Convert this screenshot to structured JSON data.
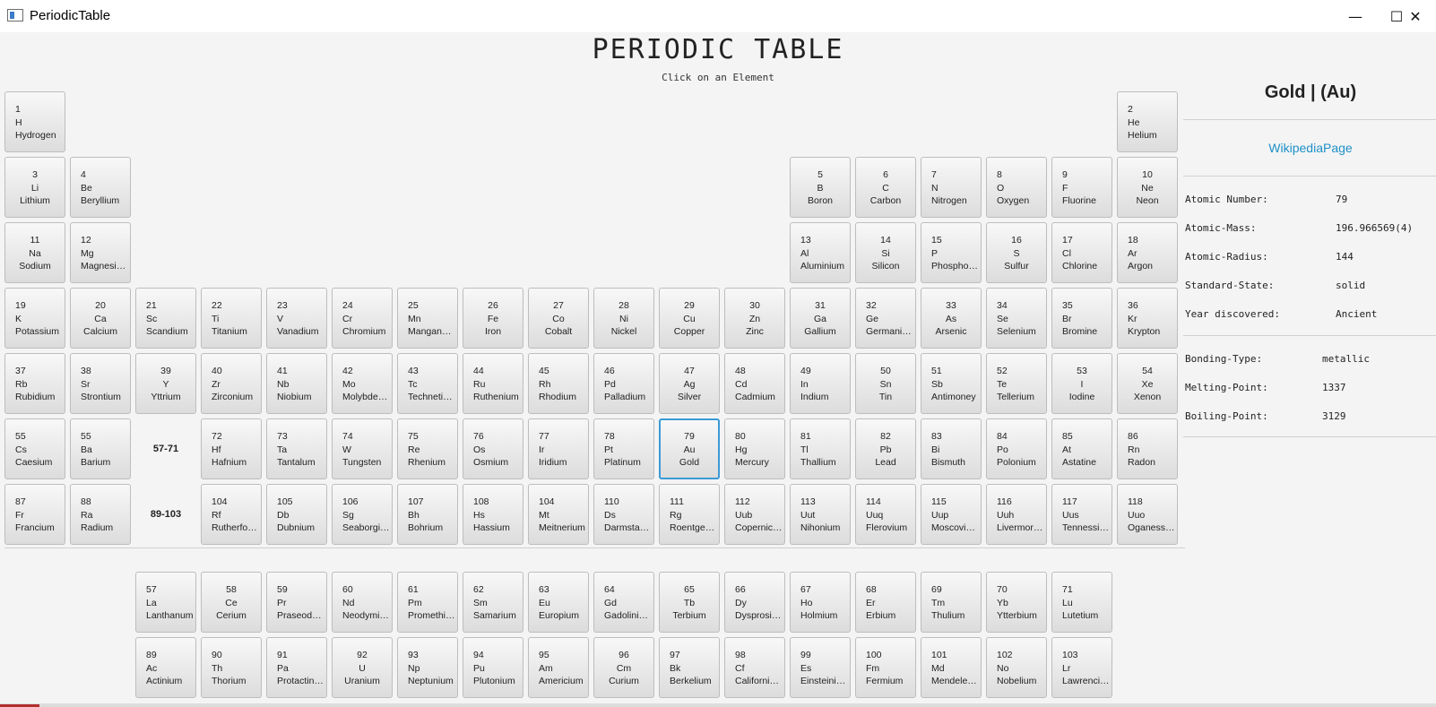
{
  "window": {
    "title": "PeriodicTable",
    "minimize_glyph": "—",
    "maximize_glyph": "☐",
    "close_glyph": "✕"
  },
  "header": {
    "title": "PERIODIC TABLE",
    "subtitle": "Click on an Element"
  },
  "elements": [
    {
      "n": "1",
      "s": "H",
      "name": "Hydrogen",
      "align": "l",
      "r": 0,
      "c": 0
    },
    {
      "n": "2",
      "s": "He",
      "name": "Helium",
      "align": "l",
      "r": 0,
      "c": 17
    },
    {
      "n": "3",
      "s": "Li",
      "name": "Lithium",
      "align": "c",
      "r": 1,
      "c": 0
    },
    {
      "n": "4",
      "s": "Be",
      "name": "Beryllium",
      "align": "l",
      "r": 1,
      "c": 1
    },
    {
      "n": "5",
      "s": "B",
      "name": "Boron",
      "align": "c",
      "r": 1,
      "c": 12
    },
    {
      "n": "6",
      "s": "C",
      "name": "Carbon",
      "align": "c",
      "r": 1,
      "c": 13
    },
    {
      "n": "7",
      "s": "N",
      "name": "Nitrogen",
      "align": "l",
      "r": 1,
      "c": 14
    },
    {
      "n": "8",
      "s": "O",
      "name": "Oxygen",
      "align": "l",
      "r": 1,
      "c": 15
    },
    {
      "n": "9",
      "s": "F",
      "name": "Fluorine",
      "align": "l",
      "r": 1,
      "c": 16
    },
    {
      "n": "10",
      "s": "Ne",
      "name": "Neon",
      "align": "c",
      "r": 1,
      "c": 17
    },
    {
      "n": "11",
      "s": "Na",
      "name": "Sodium",
      "align": "c",
      "r": 2,
      "c": 0
    },
    {
      "n": "12",
      "s": "Mg",
      "name": "Magnesium",
      "align": "l",
      "r": 2,
      "c": 1
    },
    {
      "n": "13",
      "s": "Al",
      "name": "Aluminium",
      "align": "l",
      "r": 2,
      "c": 12
    },
    {
      "n": "14",
      "s": "Si",
      "name": "Silicon",
      "align": "c",
      "r": 2,
      "c": 13
    },
    {
      "n": "15",
      "s": "P",
      "name": "Phosphorus",
      "align": "l",
      "r": 2,
      "c": 14
    },
    {
      "n": "16",
      "s": "S",
      "name": "Sulfur",
      "align": "c",
      "r": 2,
      "c": 15
    },
    {
      "n": "17",
      "s": "Cl",
      "name": "Chlorine",
      "align": "l",
      "r": 2,
      "c": 16
    },
    {
      "n": "18",
      "s": "Ar",
      "name": "Argon",
      "align": "l",
      "r": 2,
      "c": 17
    },
    {
      "n": "19",
      "s": "K",
      "name": "Potassium",
      "align": "l",
      "r": 3,
      "c": 0
    },
    {
      "n": "20",
      "s": "Ca",
      "name": "Calcium",
      "align": "c",
      "r": 3,
      "c": 1
    },
    {
      "n": "21",
      "s": "Sc",
      "name": "Scandium",
      "align": "l",
      "r": 3,
      "c": 2
    },
    {
      "n": "22",
      "s": "Ti",
      "name": "Titanium",
      "align": "l",
      "r": 3,
      "c": 3
    },
    {
      "n": "23",
      "s": "V",
      "name": "Vanadium",
      "align": "l",
      "r": 3,
      "c": 4
    },
    {
      "n": "24",
      "s": "Cr",
      "name": "Chromium",
      "align": "l",
      "r": 3,
      "c": 5
    },
    {
      "n": "25",
      "s": "Mn",
      "name": "Manganese",
      "align": "l",
      "r": 3,
      "c": 6
    },
    {
      "n": "26",
      "s": "Fe",
      "name": "Iron",
      "align": "c",
      "r": 3,
      "c": 7
    },
    {
      "n": "27",
      "s": "Co",
      "name": "Cobalt",
      "align": "c",
      "r": 3,
      "c": 8
    },
    {
      "n": "28",
      "s": "Ni",
      "name": "Nickel",
      "align": "c",
      "r": 3,
      "c": 9
    },
    {
      "n": "29",
      "s": "Cu",
      "name": "Copper",
      "align": "c",
      "r": 3,
      "c": 10
    },
    {
      "n": "30",
      "s": "Zn",
      "name": "Zinc",
      "align": "c",
      "r": 3,
      "c": 11
    },
    {
      "n": "31",
      "s": "Ga",
      "name": "Gallium",
      "align": "c",
      "r": 3,
      "c": 12
    },
    {
      "n": "32",
      "s": "Ge",
      "name": "Germanium",
      "align": "l",
      "r": 3,
      "c": 13
    },
    {
      "n": "33",
      "s": "As",
      "name": "Arsenic",
      "align": "c",
      "r": 3,
      "c": 14
    },
    {
      "n": "34",
      "s": "Se",
      "name": "Selenium",
      "align": "l",
      "r": 3,
      "c": 15
    },
    {
      "n": "35",
      "s": "Br",
      "name": "Bromine",
      "align": "l",
      "r": 3,
      "c": 16
    },
    {
      "n": "36",
      "s": "Kr",
      "name": "Krypton",
      "align": "l",
      "r": 3,
      "c": 17
    },
    {
      "n": "37",
      "s": "Rb",
      "name": "Rubidium",
      "align": "l",
      "r": 4,
      "c": 0
    },
    {
      "n": "38",
      "s": "Sr",
      "name": "Strontium",
      "align": "l",
      "r": 4,
      "c": 1
    },
    {
      "n": "39",
      "s": "Y",
      "name": "Yttrium",
      "align": "c",
      "r": 4,
      "c": 2
    },
    {
      "n": "40",
      "s": "Zr",
      "name": "Zirconium",
      "align": "l",
      "r": 4,
      "c": 3
    },
    {
      "n": "41",
      "s": "Nb",
      "name": "Niobium",
      "align": "l",
      "r": 4,
      "c": 4
    },
    {
      "n": "42",
      "s": "Mo",
      "name": "Molybde…",
      "align": "l",
      "r": 4,
      "c": 5
    },
    {
      "n": "43",
      "s": "Tc",
      "name": "Technetium",
      "align": "l",
      "r": 4,
      "c": 6
    },
    {
      "n": "44",
      "s": "Ru",
      "name": "Ruthenium",
      "align": "l",
      "r": 4,
      "c": 7
    },
    {
      "n": "45",
      "s": "Rh",
      "name": "Rhodium",
      "align": "l",
      "r": 4,
      "c": 8
    },
    {
      "n": "46",
      "s": "Pd",
      "name": "Palladium",
      "align": "l",
      "r": 4,
      "c": 9
    },
    {
      "n": "47",
      "s": "Ag",
      "name": "Silver",
      "align": "c",
      "r": 4,
      "c": 10
    },
    {
      "n": "48",
      "s": "Cd",
      "name": "Cadmium",
      "align": "l",
      "r": 4,
      "c": 11
    },
    {
      "n": "49",
      "s": "In",
      "name": "Indium",
      "align": "l",
      "r": 4,
      "c": 12
    },
    {
      "n": "50",
      "s": "Sn",
      "name": "Tin",
      "align": "c",
      "r": 4,
      "c": 13
    },
    {
      "n": "51",
      "s": "Sb",
      "name": "Antimoney",
      "align": "l",
      "r": 4,
      "c": 14
    },
    {
      "n": "52",
      "s": "Te",
      "name": "Tellerium",
      "align": "l",
      "r": 4,
      "c": 15
    },
    {
      "n": "53",
      "s": "I",
      "name": "Iodine",
      "align": "c",
      "r": 4,
      "c": 16
    },
    {
      "n": "54",
      "s": "Xe",
      "name": "Xenon",
      "align": "c",
      "r": 4,
      "c": 17
    },
    {
      "n": "55",
      "s": "Cs",
      "name": "Caesium",
      "align": "l",
      "r": 5,
      "c": 0
    },
    {
      "n": "55",
      "s": "Ba",
      "name": "Barium",
      "align": "l",
      "r": 5,
      "c": 1
    },
    {
      "n": "72",
      "s": "Hf",
      "name": "Hafnium",
      "align": "l",
      "r": 5,
      "c": 3
    },
    {
      "n": "73",
      "s": "Ta",
      "name": "Tantalum",
      "align": "l",
      "r": 5,
      "c": 4
    },
    {
      "n": "74",
      "s": "W",
      "name": "Tungsten",
      "align": "l",
      "r": 5,
      "c": 5
    },
    {
      "n": "75",
      "s": "Re",
      "name": "Rhenium",
      "align": "l",
      "r": 5,
      "c": 6
    },
    {
      "n": "76",
      "s": "Os",
      "name": "Osmium",
      "align": "l",
      "r": 5,
      "c": 7
    },
    {
      "n": "77",
      "s": "Ir",
      "name": "Iridium",
      "align": "l",
      "r": 5,
      "c": 8
    },
    {
      "n": "78",
      "s": "Pt",
      "name": "Platinum",
      "align": "l",
      "r": 5,
      "c": 9
    },
    {
      "n": "79",
      "s": "Au",
      "name": "Gold",
      "align": "c",
      "r": 5,
      "c": 10,
      "selected": true
    },
    {
      "n": "80",
      "s": "Hg",
      "name": "Mercury",
      "align": "l",
      "r": 5,
      "c": 11
    },
    {
      "n": "81",
      "s": "Tl",
      "name": "Thallium",
      "align": "l",
      "r": 5,
      "c": 12
    },
    {
      "n": "82",
      "s": "Pb",
      "name": "Lead",
      "align": "c",
      "r": 5,
      "c": 13
    },
    {
      "n": "83",
      "s": "Bi",
      "name": "Bismuth",
      "align": "l",
      "r": 5,
      "c": 14
    },
    {
      "n": "84",
      "s": "Po",
      "name": "Polonium",
      "align": "l",
      "r": 5,
      "c": 15
    },
    {
      "n": "85",
      "s": "At",
      "name": "Astatine",
      "align": "l",
      "r": 5,
      "c": 16
    },
    {
      "n": "86",
      "s": "Rn",
      "name": "Radon",
      "align": "l",
      "r": 5,
      "c": 17
    },
    {
      "n": "87",
      "s": "Fr",
      "name": "Francium",
      "align": "l",
      "r": 6,
      "c": 0
    },
    {
      "n": "88",
      "s": "Ra",
      "name": "Radium",
      "align": "l",
      "r": 6,
      "c": 1
    },
    {
      "n": "104",
      "s": "Rf",
      "name": "Rutherfor…",
      "align": "l",
      "r": 6,
      "c": 3
    },
    {
      "n": "105",
      "s": "Db",
      "name": "Dubnium",
      "align": "l",
      "r": 6,
      "c": 4
    },
    {
      "n": "106",
      "s": "Sg",
      "name": "Seaborgi…",
      "align": "l",
      "r": 6,
      "c": 5
    },
    {
      "n": "107",
      "s": "Bh",
      "name": "Bohrium",
      "align": "l",
      "r": 6,
      "c": 6
    },
    {
      "n": "108",
      "s": "Hs",
      "name": "Hassium",
      "align": "l",
      "r": 6,
      "c": 7
    },
    {
      "n": "104",
      "s": "Mt",
      "name": "Meitnerium",
      "align": "l",
      "r": 6,
      "c": 8
    },
    {
      "n": "110",
      "s": "Ds",
      "name": "Darmstad…",
      "align": "l",
      "r": 6,
      "c": 9
    },
    {
      "n": "111",
      "s": "Rg",
      "name": "Roentgen…",
      "align": "l",
      "r": 6,
      "c": 10
    },
    {
      "n": "112",
      "s": "Uub",
      "name": "Copernici…",
      "align": "l",
      "r": 6,
      "c": 11
    },
    {
      "n": "113",
      "s": "Uut",
      "name": "Nihonium",
      "align": "l",
      "r": 6,
      "c": 12
    },
    {
      "n": "114",
      "s": "Uuq",
      "name": "Flerovium",
      "align": "l",
      "r": 6,
      "c": 13
    },
    {
      "n": "115",
      "s": "Uup",
      "name": "Moscovium",
      "align": "l",
      "r": 6,
      "c": 14
    },
    {
      "n": "116",
      "s": "Uuh",
      "name": "Livermori…",
      "align": "l",
      "r": 6,
      "c": 15
    },
    {
      "n": "117",
      "s": "Uus",
      "name": "Tennessine",
      "align": "l",
      "r": 6,
      "c": 16
    },
    {
      "n": "118",
      "s": "Uuo",
      "name": "Oganesson",
      "align": "l",
      "r": 6,
      "c": 17
    },
    {
      "n": "57",
      "s": "La",
      "name": "Lanthanum",
      "align": "l",
      "r": 7,
      "c": 2
    },
    {
      "n": "58",
      "s": "Ce",
      "name": "Cerium",
      "align": "c",
      "r": 7,
      "c": 3
    },
    {
      "n": "59",
      "s": "Pr",
      "name": "Praseody…",
      "align": "l",
      "r": 7,
      "c": 4
    },
    {
      "n": "60",
      "s": "Nd",
      "name": "Neodymi…",
      "align": "l",
      "r": 7,
      "c": 5
    },
    {
      "n": "61",
      "s": "Pm",
      "name": "Promethi…",
      "align": "l",
      "r": 7,
      "c": 6
    },
    {
      "n": "62",
      "s": "Sm",
      "name": "Samarium",
      "align": "l",
      "r": 7,
      "c": 7
    },
    {
      "n": "63",
      "s": "Eu",
      "name": "Europium",
      "align": "l",
      "r": 7,
      "c": 8
    },
    {
      "n": "64",
      "s": "Gd",
      "name": "Gadolinium",
      "align": "l",
      "r": 7,
      "c": 9
    },
    {
      "n": "65",
      "s": "Tb",
      "name": "Terbium",
      "align": "c",
      "r": 7,
      "c": 10
    },
    {
      "n": "66",
      "s": "Dy",
      "name": "Dysprosium",
      "align": "l",
      "r": 7,
      "c": 11
    },
    {
      "n": "67",
      "s": "Ho",
      "name": "Holmium",
      "align": "l",
      "r": 7,
      "c": 12
    },
    {
      "n": "68",
      "s": "Er",
      "name": "Erbium",
      "align": "l",
      "r": 7,
      "c": 13
    },
    {
      "n": "69",
      "s": "Tm",
      "name": "Thulium",
      "align": "l",
      "r": 7,
      "c": 14
    },
    {
      "n": "70",
      "s": "Yb",
      "name": "Ytterbium",
      "align": "l",
      "r": 7,
      "c": 15
    },
    {
      "n": "71",
      "s": "Lu",
      "name": "Lutetium",
      "align": "l",
      "r": 7,
      "c": 16
    },
    {
      "n": "89",
      "s": "Ac",
      "name": "Actinium",
      "align": "l",
      "r": 8,
      "c": 2
    },
    {
      "n": "90",
      "s": "Th",
      "name": "Thorium",
      "align": "l",
      "r": 8,
      "c": 3
    },
    {
      "n": "91",
      "s": "Pa",
      "name": "Protactin…",
      "align": "l",
      "r": 8,
      "c": 4
    },
    {
      "n": "92",
      "s": "U",
      "name": "Uranium",
      "align": "c",
      "r": 8,
      "c": 5
    },
    {
      "n": "93",
      "s": "Np",
      "name": "Neptunium",
      "align": "l",
      "r": 8,
      "c": 6
    },
    {
      "n": "94",
      "s": "Pu",
      "name": "Plutonium",
      "align": "l",
      "r": 8,
      "c": 7
    },
    {
      "n": "95",
      "s": "Am",
      "name": "Americium",
      "align": "l",
      "r": 8,
      "c": 8
    },
    {
      "n": "96",
      "s": "Cm",
      "name": "Curium",
      "align": "c",
      "r": 8,
      "c": 9
    },
    {
      "n": "97",
      "s": "Bk",
      "name": "Berkelium",
      "align": "l",
      "r": 8,
      "c": 10
    },
    {
      "n": "98",
      "s": "Cf",
      "name": "Californium",
      "align": "l",
      "r": 8,
      "c": 11
    },
    {
      "n": "99",
      "s": "Es",
      "name": "Einsteinium",
      "align": "l",
      "r": 8,
      "c": 12
    },
    {
      "n": "100",
      "s": "Fm",
      "name": "Fermium",
      "align": "l",
      "r": 8,
      "c": 13
    },
    {
      "n": "101",
      "s": "Md",
      "name": "Mendele…",
      "align": "l",
      "r": 8,
      "c": 14
    },
    {
      "n": "102",
      "s": "No",
      "name": "Nobelium",
      "align": "l",
      "r": 8,
      "c": 15
    },
    {
      "n": "103",
      "s": "Lr",
      "name": "Lawrenci…",
      "align": "l",
      "r": 8,
      "c": 16
    }
  ],
  "ranges": [
    {
      "label": "57-71",
      "r": 5,
      "c": 2
    },
    {
      "label": "89-103",
      "r": 6,
      "c": 2
    }
  ],
  "detail": {
    "title": "Gold | (Au)",
    "wiki_link": "WikipediaPage",
    "props_a": [
      {
        "label": "Atomic Number:",
        "value": "79"
      },
      {
        "label": "Atomic-Mass:",
        "value": "196.966569(4)"
      },
      {
        "label": "Atomic-Radius:",
        "value": "144"
      },
      {
        "label": "Standard-State:",
        "value": "solid"
      },
      {
        "label": "Year discovered:",
        "value": "Ancient"
      }
    ],
    "props_b": [
      {
        "label": "Bonding-Type:",
        "value": "metallic"
      },
      {
        "label": "Melting-Point:",
        "value": "1337"
      },
      {
        "label": "Boiling-Point:",
        "value": "3129"
      }
    ]
  },
  "colors": {
    "accent": "#3c9ad6",
    "link": "#1e90c8",
    "background": "#f4f4f4"
  }
}
